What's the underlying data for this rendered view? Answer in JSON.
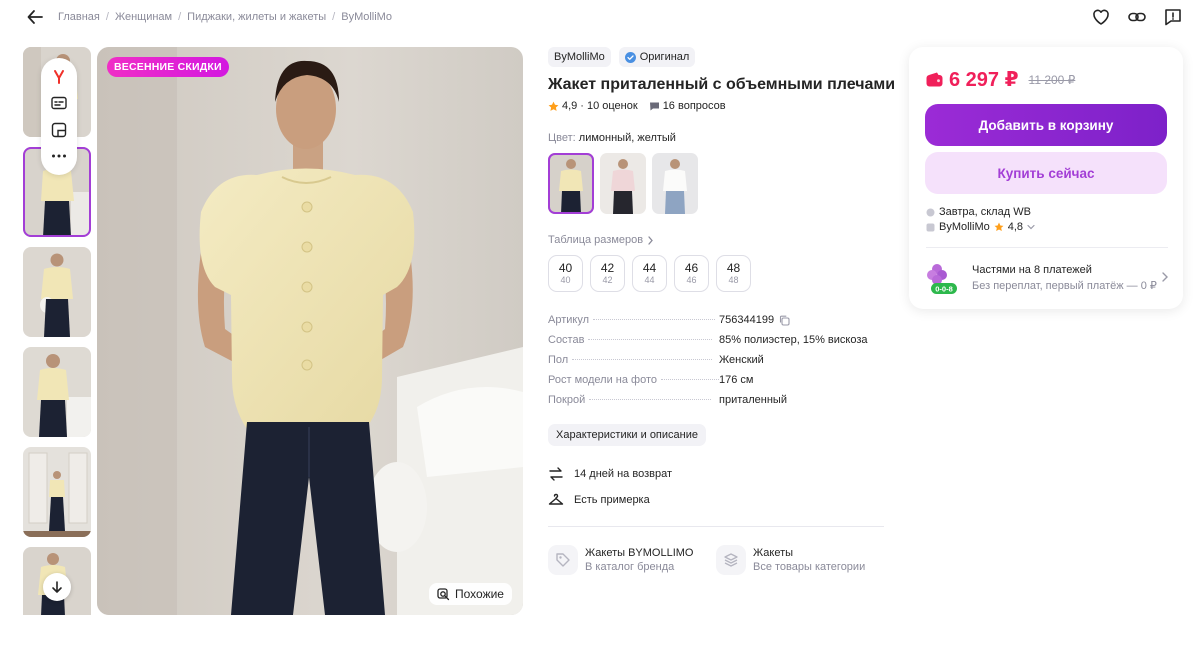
{
  "breadcrumb": [
    "Главная",
    "Женщинам",
    "Пиджаки, жилеты и жакеты",
    "ByMolliMo"
  ],
  "promo_badge": "ВЕСЕННИЕ СКИДКИ",
  "similar_label": "Похожие",
  "product": {
    "brand": "ByMolliMo",
    "original_label": "Оригинал",
    "title": "Жакет приталенный с объемными плечами",
    "rating": "4,9",
    "reviews": "10 оценок",
    "questions": "16 вопросов",
    "color_label": "Цвет:",
    "color_value": "лимонный, желтый",
    "size_table_label": "Таблица размеров",
    "sizes": [
      {
        "ru": "40",
        "eu": "40"
      },
      {
        "ru": "42",
        "eu": "42"
      },
      {
        "ru": "44",
        "eu": "44"
      },
      {
        "ru": "46",
        "eu": "46"
      },
      {
        "ru": "48",
        "eu": "48"
      }
    ],
    "specs": [
      {
        "key": "Артикул",
        "value": "756344199"
      },
      {
        "key": "Состав",
        "value": "85% полиэстер, 15% вискоза"
      },
      {
        "key": "Пол",
        "value": "Женский"
      },
      {
        "key": "Рост модели на фото",
        "value": "176 см"
      },
      {
        "key": "Покрой",
        "value": "приталенный"
      }
    ],
    "chars_button": "Характеристики и описание",
    "perks": [
      "14 дней на возврат",
      "Есть примерка"
    ],
    "links": [
      {
        "title": "Жакеты BYMOLLIMO",
        "subtitle": "В каталог бренда"
      },
      {
        "title": "Жакеты",
        "subtitle": "Все товары категории"
      }
    ]
  },
  "price_card": {
    "price": "6 297 ₽",
    "old_price": "11 200 ₽",
    "add_to_cart": "Добавить в корзину",
    "buy_now": "Купить сейчас",
    "delivery": "Завтра, склад WB",
    "seller": "ByMolliMo",
    "seller_rating": "4,8",
    "installments_title": "Частями на 8 платежей",
    "installments_sub": "Без переплат, первый платёж — 0 ₽",
    "installments_badge": "0-0-8"
  },
  "colors": {
    "accent": "#a33ed6",
    "price": "#f0205a",
    "cart_button": "#8a25cf",
    "jacket": "#f1e6b6",
    "jeans": "#1c2233"
  },
  "icons": [
    "back-arrow-icon",
    "heart-icon",
    "link-icon",
    "report-icon",
    "yandex-icon",
    "sizes-icon",
    "collage-icon",
    "more-icon",
    "arrow-down-icon",
    "similar-search-icon",
    "verified-icon",
    "star-icon",
    "chat-icon",
    "copy-icon",
    "return-icon",
    "hanger-icon",
    "tag-icon",
    "stack-icon",
    "wallet-icon",
    "warehouse-icon",
    "chevron-right-icon",
    "chevron-down-icon"
  ]
}
